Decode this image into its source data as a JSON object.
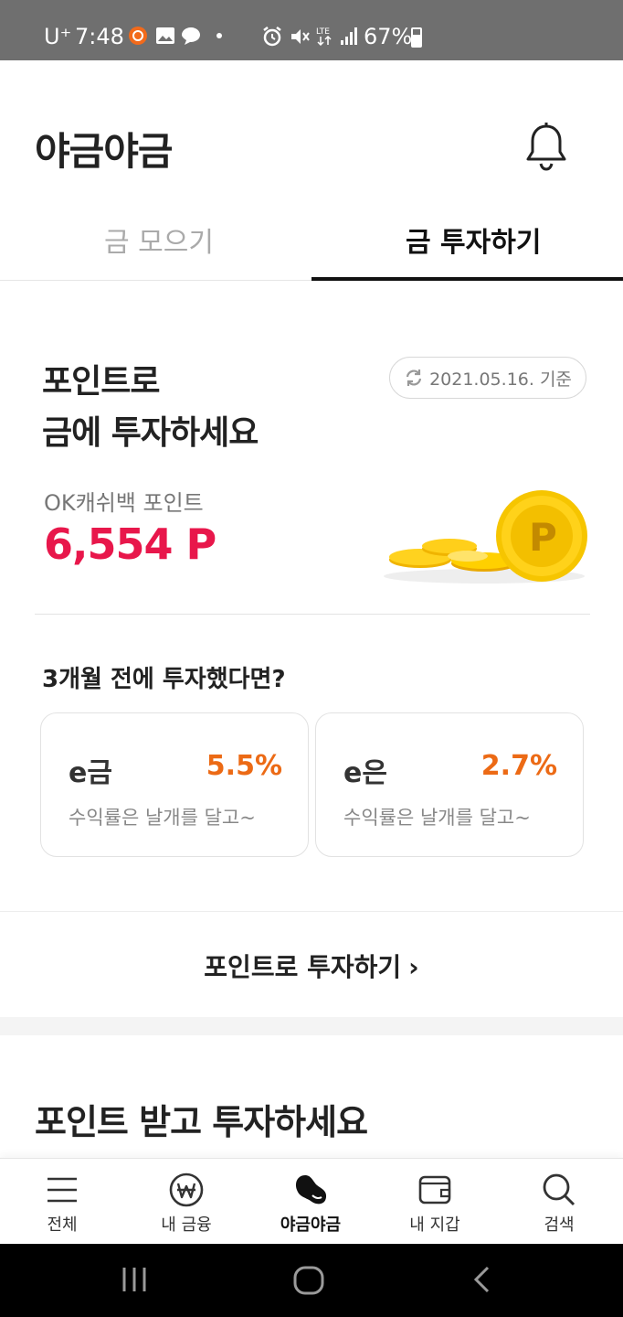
{
  "status_bar": {
    "carrier": "U⁺",
    "time": "7:48",
    "battery": "67%"
  },
  "header": {
    "title": "야금야금"
  },
  "tabs": [
    {
      "label": "금 모으기",
      "active": false
    },
    {
      "label": "금 투자하기",
      "active": true
    }
  ],
  "hero": {
    "headline_line1": "포인트로",
    "headline_line2": "금에 투자하세요",
    "date_label": "2021.05.16. 기준",
    "point_label": "OK캐쉬백 포인트",
    "point_value": "6,554 P"
  },
  "simulation": {
    "title": "3개월 전에 투자했다면?",
    "cards": [
      {
        "name": "e금",
        "rate": "5.5%",
        "desc": "수익률은 날개를 달고~"
      },
      {
        "name": "e은",
        "rate": "2.7%",
        "desc": "수익률은 날개를 달고~"
      }
    ]
  },
  "cta": {
    "label": "포인트로 투자하기",
    "chevron": "›"
  },
  "section2": {
    "title": "포인트 받고 투자하세요"
  },
  "bottom_nav": [
    {
      "label": "전체",
      "icon": "menu-icon",
      "active": false
    },
    {
      "label": "내 금융",
      "icon": "won-icon",
      "active": false
    },
    {
      "label": "야금야금",
      "icon": "bean-icon",
      "active": true
    },
    {
      "label": "내 지갑",
      "icon": "wallet-icon",
      "active": false
    },
    {
      "label": "검색",
      "icon": "search-icon",
      "active": false
    }
  ],
  "colors": {
    "point_red": "#e8174b",
    "rate_orange": "#ec6a15",
    "status_bar": "#6f6f6f"
  }
}
